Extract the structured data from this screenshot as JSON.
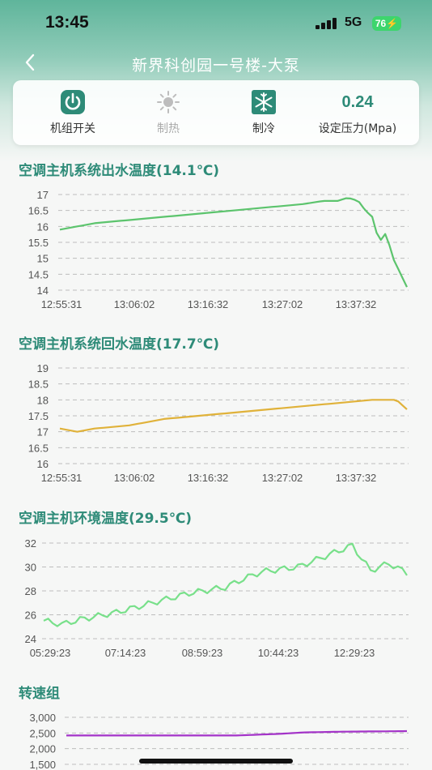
{
  "status_bar": {
    "time": "13:45",
    "network": "5G",
    "battery": "76"
  },
  "nav": {
    "title": "新界科创园一号楼-大泵"
  },
  "controls": {
    "power_label": "机组开关",
    "heat_label": "制热",
    "cool_label": "制冷",
    "pressure_value": "0.24",
    "pressure_label": "设定压力(Mpa)"
  },
  "sections": {
    "outlet_title": "空调主机系统出水温度(14.1℃)",
    "return_title": "空调主机系统回水温度(17.7℃)",
    "ambient_title": "空调主机环境温度(29.5℃)",
    "speed_title": "转速组"
  },
  "colors": {
    "green_line": "#5cc46d",
    "yellow_line": "#e0b23a",
    "light_green_line": "#78e08a",
    "purple_line": "#a333c8",
    "accent": "#2e8b78"
  },
  "chart_data": [
    {
      "type": "line",
      "title": "空调主机系统出水温度(14.1℃)",
      "x_ticks": [
        "12:55:31",
        "13:06:02",
        "13:16:32",
        "13:27:02",
        "13:37:32"
      ],
      "y_ticks": [
        17,
        16.5,
        16,
        15.5,
        15,
        14.5,
        14
      ],
      "ylim": [
        14,
        17
      ],
      "grid": true,
      "x": [
        0,
        0.05,
        0.1,
        0.2,
        0.3,
        0.4,
        0.5,
        0.6,
        0.7,
        0.76,
        0.8,
        0.83,
        0.86,
        0.88,
        0.9,
        0.92,
        0.94,
        0.96,
        1.0
      ],
      "values": [
        15.9,
        16.0,
        16.1,
        16.2,
        16.3,
        16.4,
        16.5,
        16.6,
        16.7,
        16.8,
        16.8,
        16.9,
        16.8,
        16.5,
        16.3,
        15.5,
        15.8,
        15.0,
        14.1
      ]
    },
    {
      "type": "line",
      "title": "空调主机系统回水温度(17.7℃)",
      "x_ticks": [
        "12:55:31",
        "13:06:02",
        "13:16:32",
        "13:27:02",
        "13:37:32"
      ],
      "y_ticks": [
        19,
        18.5,
        18,
        17.5,
        17,
        16.5,
        16
      ],
      "ylim": [
        16,
        19
      ],
      "grid": true,
      "x": [
        0,
        0.05,
        0.1,
        0.2,
        0.3,
        0.4,
        0.5,
        0.6,
        0.7,
        0.8,
        0.9,
        0.97,
        1.0
      ],
      "values": [
        17.1,
        17.0,
        17.1,
        17.2,
        17.4,
        17.5,
        17.6,
        17.7,
        17.8,
        17.9,
        18.0,
        18.0,
        17.7
      ]
    },
    {
      "type": "line",
      "title": "空调主机环境温度(29.5℃)",
      "x_ticks": [
        "05:29:23",
        "07:14:23",
        "08:59:23",
        "10:44:23",
        "12:29:23"
      ],
      "y_ticks": [
        32,
        30,
        28,
        26,
        24
      ],
      "ylim": [
        24,
        32
      ],
      "grid": true,
      "x": [
        0,
        0.05,
        0.1,
        0.2,
        0.3,
        0.4,
        0.5,
        0.55,
        0.6,
        0.7,
        0.75,
        0.8,
        0.85,
        0.88,
        0.9,
        0.95,
        1.0
      ],
      "values": [
        25.5,
        25.2,
        25.6,
        26.2,
        27.0,
        27.8,
        28.3,
        29.0,
        29.6,
        30.0,
        30.6,
        31.2,
        31.8,
        30.5,
        29.7,
        30.3,
        29.5
      ]
    },
    {
      "type": "line",
      "title": "转速组",
      "y_ticks": [
        "3,000",
        "2,500",
        "2,000",
        "1,500"
      ],
      "ylim": [
        1500,
        3000
      ],
      "grid": true,
      "x": [
        0,
        0.5,
        0.62,
        0.7,
        0.8,
        1.0
      ],
      "values": [
        2420,
        2420,
        2470,
        2520,
        2540,
        2560
      ]
    }
  ]
}
